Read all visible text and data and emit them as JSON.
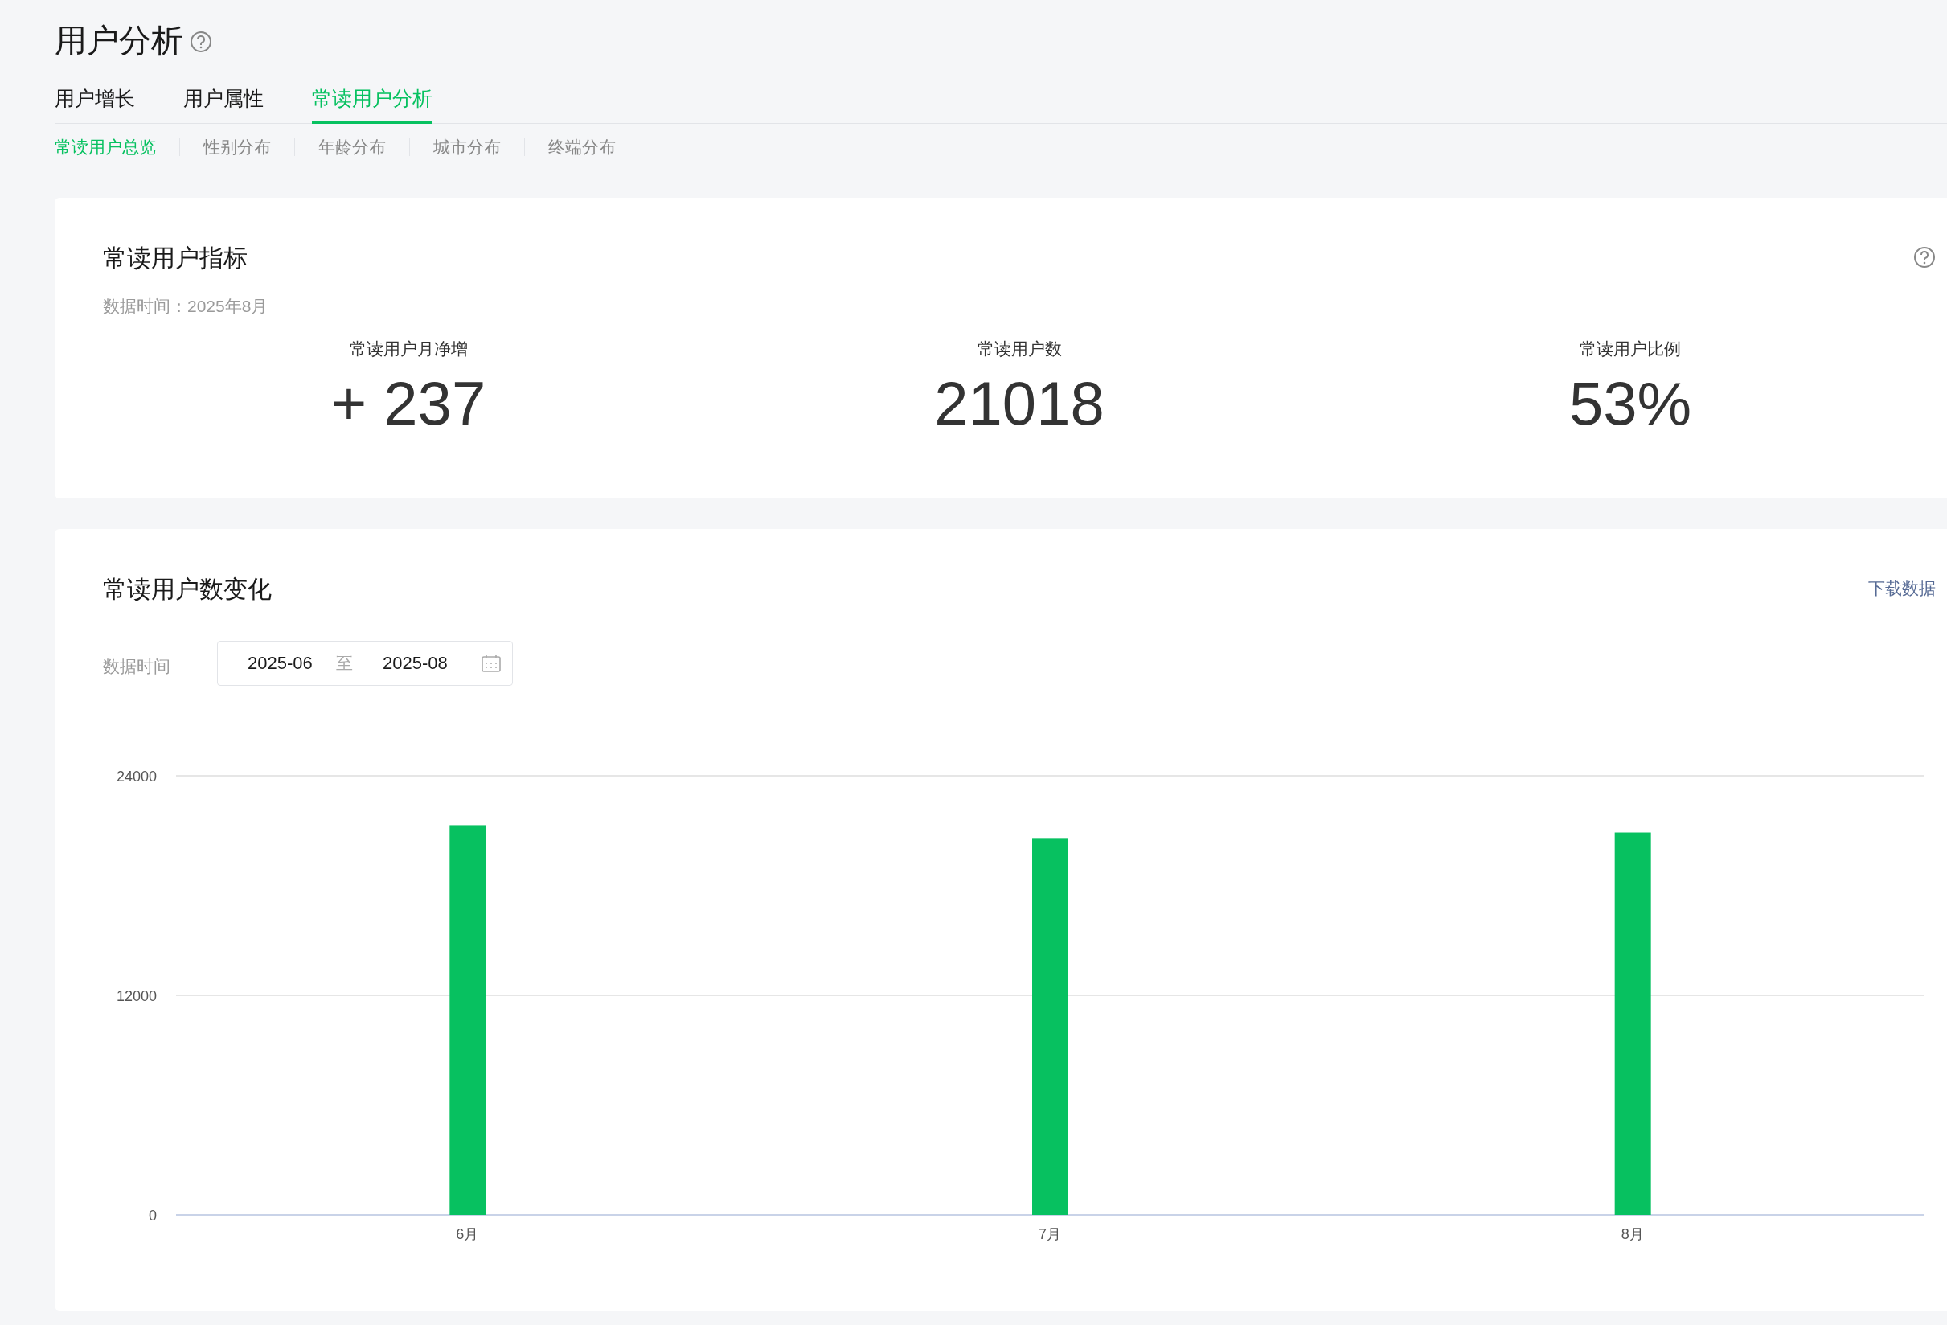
{
  "page": {
    "title": "用户分析"
  },
  "tabs": [
    {
      "label": "用户增长",
      "selected": false
    },
    {
      "label": "用户属性",
      "selected": false
    },
    {
      "label": "常读用户分析",
      "selected": true
    }
  ],
  "sub_tabs": [
    {
      "label": "常读用户总览",
      "selected": true
    },
    {
      "label": "性别分布",
      "selected": false
    },
    {
      "label": "年龄分布",
      "selected": false
    },
    {
      "label": "城市分布",
      "selected": false
    },
    {
      "label": "终端分布",
      "selected": false
    }
  ],
  "metrics_card": {
    "title": "常读用户指标",
    "data_time": "数据时间：2025年8月",
    "metrics": [
      {
        "label": "常读用户月净增",
        "value": "+ 237"
      },
      {
        "label": "常读用户数",
        "value": "21018"
      },
      {
        "label": "常读用户比例",
        "value": "53%"
      }
    ]
  },
  "trend_card": {
    "title": "常读用户数变化",
    "download_link": "下载数据",
    "date_label": "数据时间",
    "date_start": "2025-06",
    "date_separator": "至",
    "date_end": "2025-08",
    "chart_data": {
      "type": "bar",
      "categories": [
        "6月",
        "7月",
        "8月"
      ],
      "series": [
        {
          "color": "#07c160",
          "values": [
            21300,
            20600,
            20900
          ]
        }
      ],
      "ylim": [
        0,
        24000
      ],
      "yticks": [
        0,
        12000,
        24000
      ]
    }
  }
}
